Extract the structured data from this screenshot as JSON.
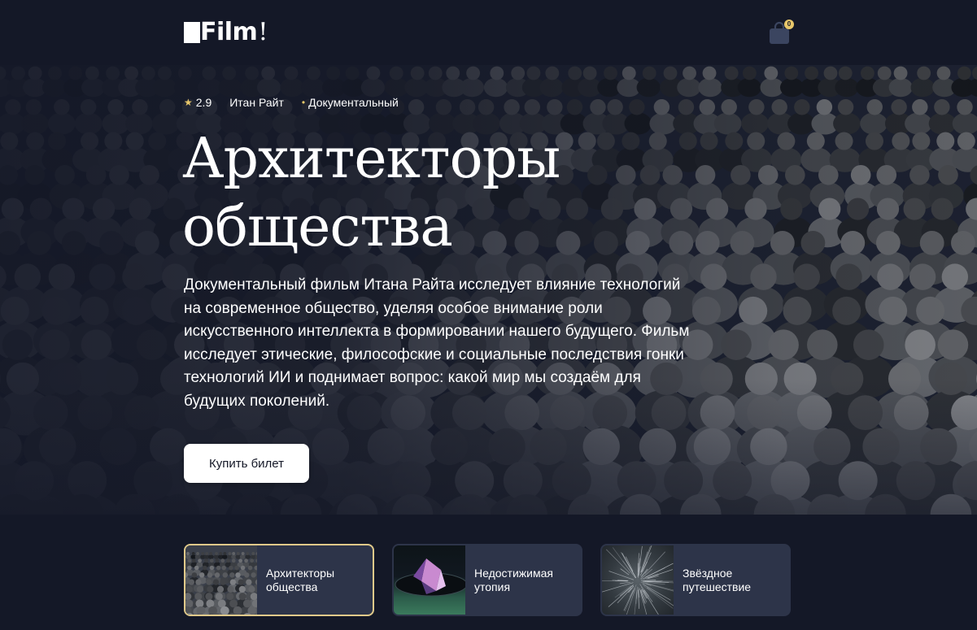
{
  "header": {
    "logo_text": "Film",
    "logo_excl": "!",
    "cart_count": "0",
    "cart_icon": "shopping-bag-icon"
  },
  "hero": {
    "rating": "2.9",
    "rating_icon": "star-icon",
    "director": "Итан Райт",
    "genre": "Документальный",
    "title": "Архитекторы общества",
    "description": "Документальный фильм Итана Райта исследует влияние технологий на современное общество, уделяя особое внимание роли искусственного интеллекта в формировании нашего будущего. Фильм исследует этические, философские и социальные последствия гонки технологий ИИ и поднимает вопрос: какой мир мы создаём для будущих поколений.",
    "buy_label": "Купить билет"
  },
  "films": [
    {
      "title": "Архитекторы общества",
      "active": true,
      "thumb": "crowd"
    },
    {
      "title": "Недостижимая утопия",
      "active": false,
      "thumb": "prism"
    },
    {
      "title": "Звёздное путешествие",
      "active": false,
      "thumb": "starfield"
    }
  ],
  "colors": {
    "background": "#141827",
    "card": "#2d3449",
    "accent": "#e8c76a",
    "active_border": "#e0c98a"
  }
}
